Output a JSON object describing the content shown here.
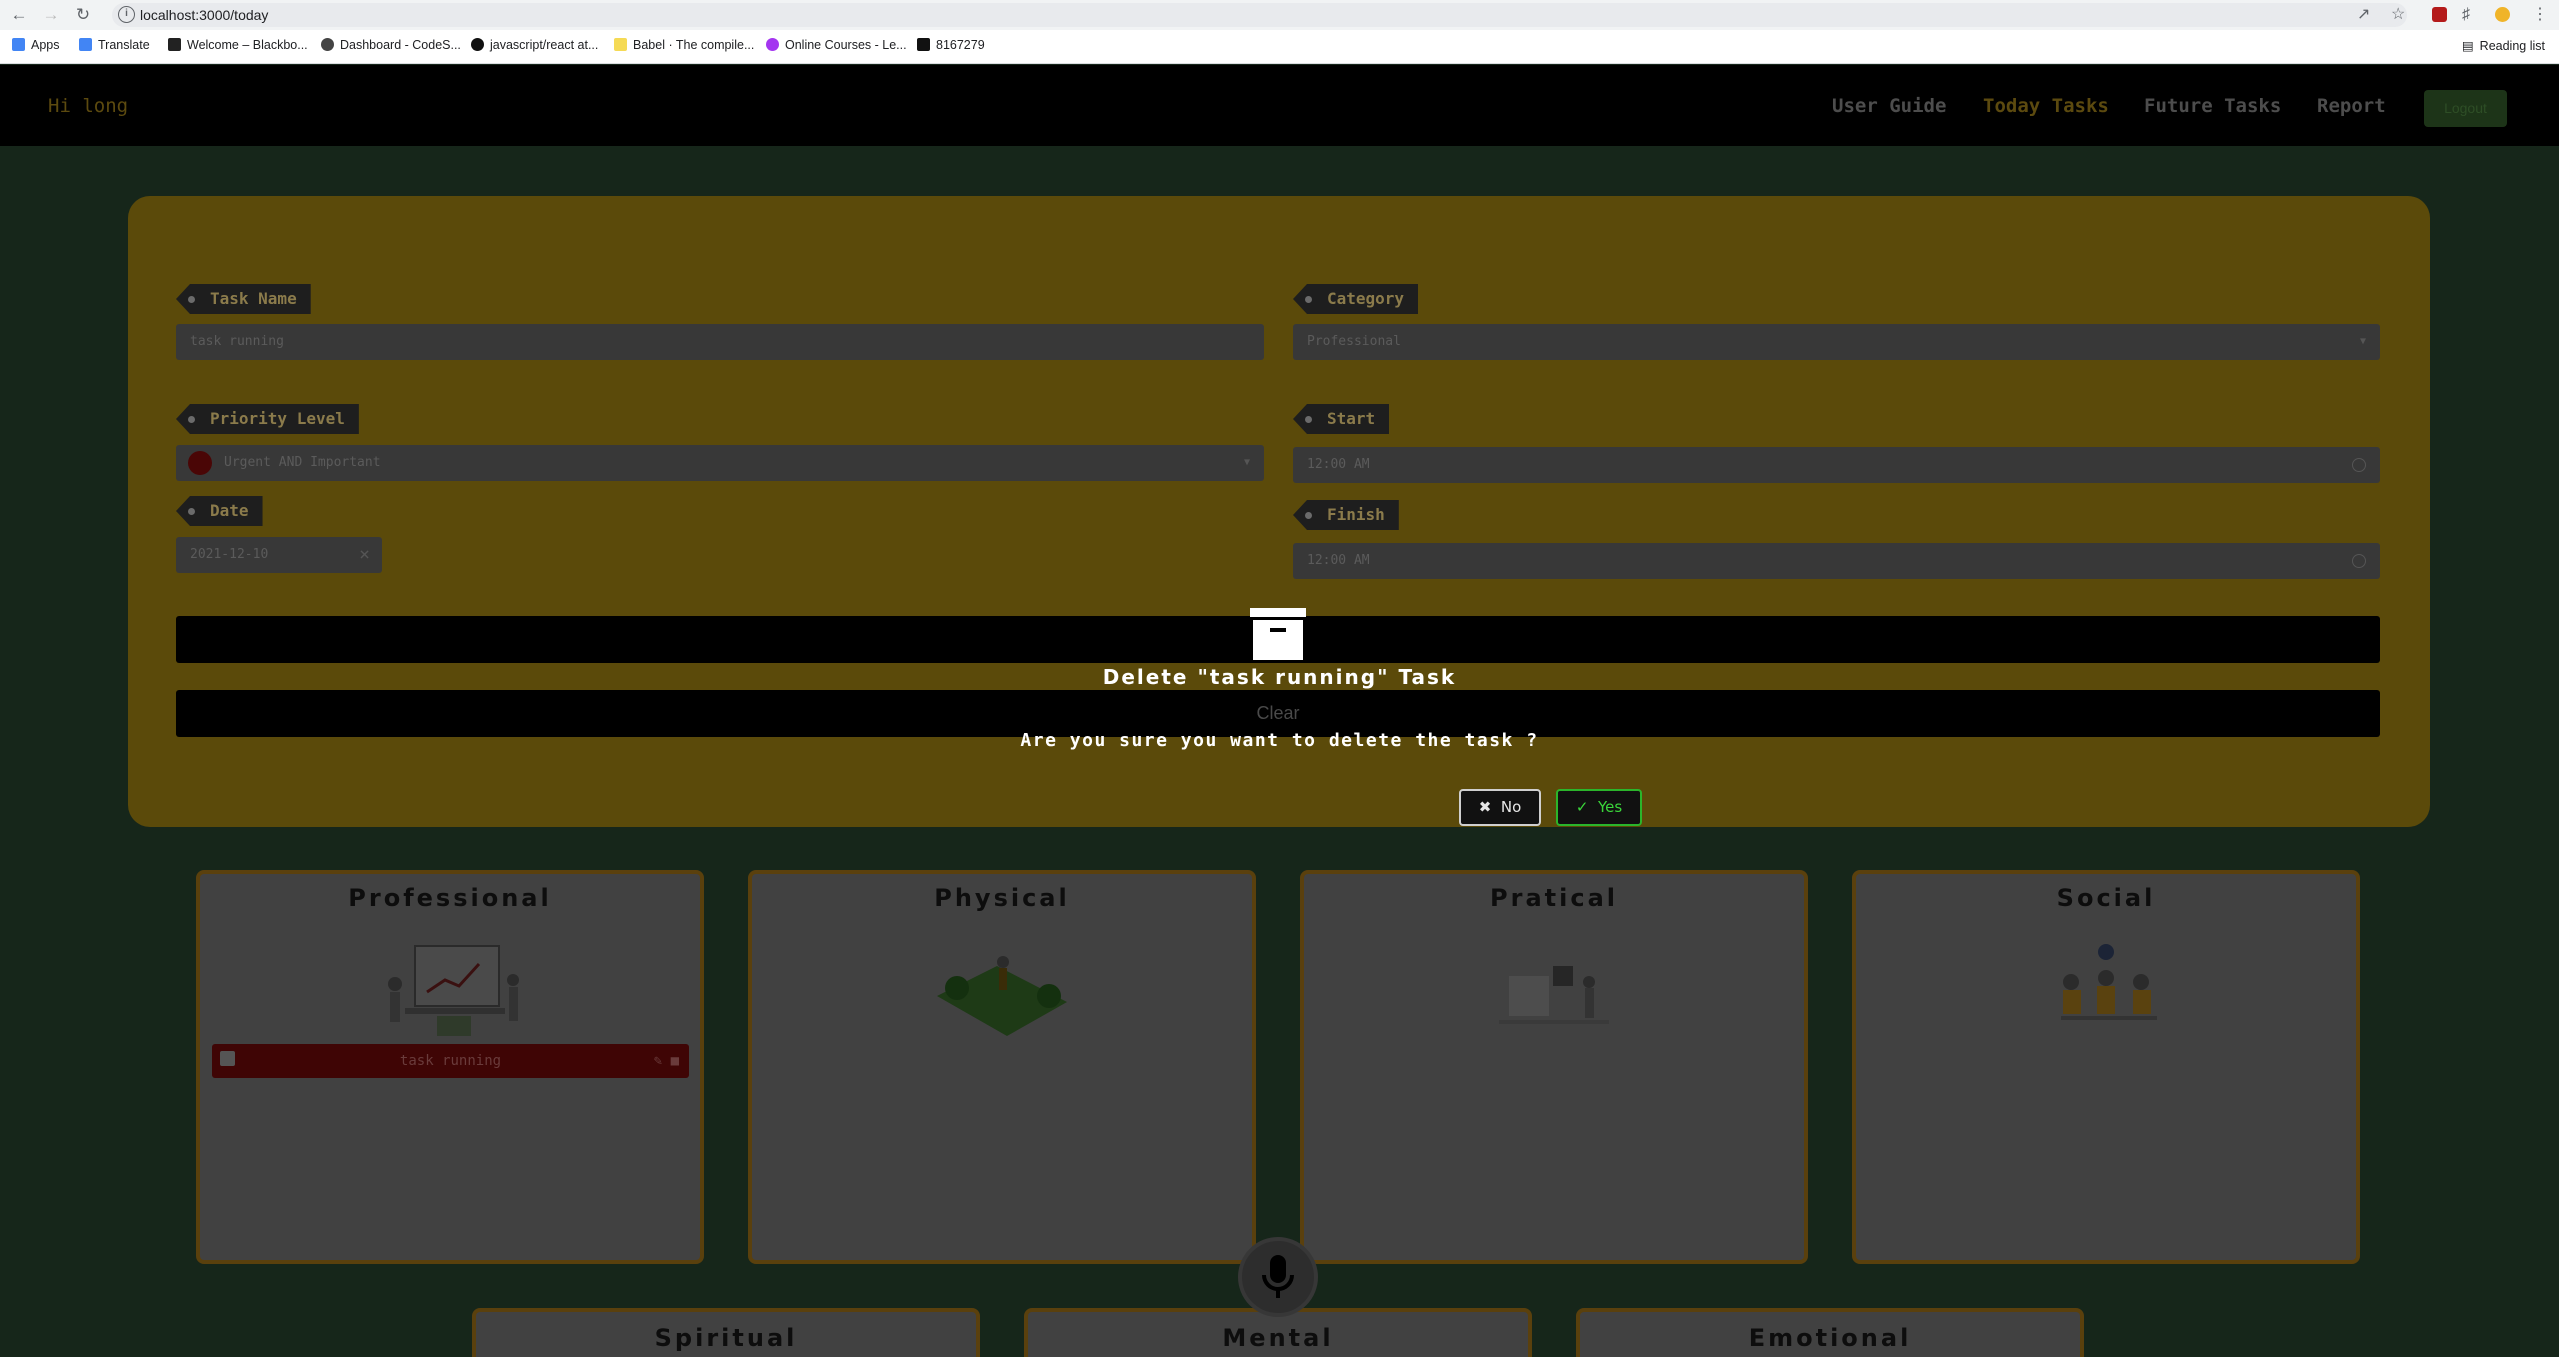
{
  "browser": {
    "url": "localhost:3000/today",
    "bookmarks": [
      {
        "label": "Apps",
        "color": "#4285f4"
      },
      {
        "label": "Translate",
        "color": "#4285f4"
      },
      {
        "label": "Welcome – Blackbo...",
        "color": "#222222"
      },
      {
        "label": "Dashboard - CodeS...",
        "color": "#444444"
      },
      {
        "label": "javascript/react at...",
        "color": "#111111"
      },
      {
        "label": "Babel · The compile...",
        "color": "#f5da55"
      },
      {
        "label": "Online Courses - Le...",
        "color": "#a435f0"
      },
      {
        "label": "8167279",
        "color": "#111111"
      }
    ],
    "reading_list": "Reading list"
  },
  "header": {
    "greeting": "Hi long",
    "nav": [
      "User Guide",
      "Today Tasks",
      "Future Tasks",
      "Report"
    ],
    "active_nav": "Today Tasks",
    "logout": "Logout"
  },
  "form": {
    "task_name_label": "Task Name",
    "task_name_value": "task running",
    "category_label": "Category",
    "category_value": "Professional",
    "priority_label": "Priority Level",
    "priority_value": "Urgent AND Important",
    "start_label": "Start",
    "start_value": "12:00 AM",
    "date_label": "Date",
    "date_value": "2021-12-10",
    "finish_label": "Finish",
    "finish_value": "12:00 AM",
    "clear_label": "Clear"
  },
  "categories": [
    {
      "title": "Professional",
      "tasks": [
        "task running"
      ]
    },
    {
      "title": "Physical",
      "tasks": []
    },
    {
      "title": "Pratical",
      "tasks": []
    },
    {
      "title": "Social",
      "tasks": []
    }
  ],
  "categories_row2": [
    "Spiritual",
    "Mental",
    "Emotional"
  ],
  "dialog": {
    "title": "Delete \"task running\" Task",
    "message": "Are you sure you want to delete the task ?",
    "no_label": "No",
    "yes_label": "Yes"
  },
  "colors": {
    "accent_gold": "#ffcf00",
    "panel": "#5b4a0a",
    "confirm_green": "#2bb52b",
    "task_red": "#3f0505"
  }
}
